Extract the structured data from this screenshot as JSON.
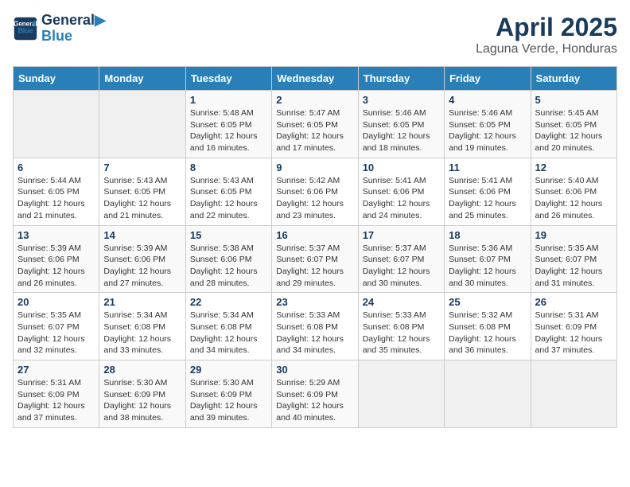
{
  "logo": {
    "line1": "General",
    "line2": "Blue"
  },
  "title": "April 2025",
  "subtitle": "Laguna Verde, Honduras",
  "headers": [
    "Sunday",
    "Monday",
    "Tuesday",
    "Wednesday",
    "Thursday",
    "Friday",
    "Saturday"
  ],
  "rows": [
    [
      {
        "empty": true
      },
      {
        "empty": true
      },
      {
        "day": 1,
        "sunrise": "5:48 AM",
        "sunset": "6:05 PM",
        "daylight": "12 hours and 16 minutes."
      },
      {
        "day": 2,
        "sunrise": "5:47 AM",
        "sunset": "6:05 PM",
        "daylight": "12 hours and 17 minutes."
      },
      {
        "day": 3,
        "sunrise": "5:46 AM",
        "sunset": "6:05 PM",
        "daylight": "12 hours and 18 minutes."
      },
      {
        "day": 4,
        "sunrise": "5:46 AM",
        "sunset": "6:05 PM",
        "daylight": "12 hours and 19 minutes."
      },
      {
        "day": 5,
        "sunrise": "5:45 AM",
        "sunset": "6:05 PM",
        "daylight": "12 hours and 20 minutes."
      }
    ],
    [
      {
        "day": 6,
        "sunrise": "5:44 AM",
        "sunset": "6:05 PM",
        "daylight": "12 hours and 21 minutes."
      },
      {
        "day": 7,
        "sunrise": "5:43 AM",
        "sunset": "6:05 PM",
        "daylight": "12 hours and 21 minutes."
      },
      {
        "day": 8,
        "sunrise": "5:43 AM",
        "sunset": "6:05 PM",
        "daylight": "12 hours and 22 minutes."
      },
      {
        "day": 9,
        "sunrise": "5:42 AM",
        "sunset": "6:06 PM",
        "daylight": "12 hours and 23 minutes."
      },
      {
        "day": 10,
        "sunrise": "5:41 AM",
        "sunset": "6:06 PM",
        "daylight": "12 hours and 24 minutes."
      },
      {
        "day": 11,
        "sunrise": "5:41 AM",
        "sunset": "6:06 PM",
        "daylight": "12 hours and 25 minutes."
      },
      {
        "day": 12,
        "sunrise": "5:40 AM",
        "sunset": "6:06 PM",
        "daylight": "12 hours and 26 minutes."
      }
    ],
    [
      {
        "day": 13,
        "sunrise": "5:39 AM",
        "sunset": "6:06 PM",
        "daylight": "12 hours and 26 minutes."
      },
      {
        "day": 14,
        "sunrise": "5:39 AM",
        "sunset": "6:06 PM",
        "daylight": "12 hours and 27 minutes."
      },
      {
        "day": 15,
        "sunrise": "5:38 AM",
        "sunset": "6:06 PM",
        "daylight": "12 hours and 28 minutes."
      },
      {
        "day": 16,
        "sunrise": "5:37 AM",
        "sunset": "6:07 PM",
        "daylight": "12 hours and 29 minutes."
      },
      {
        "day": 17,
        "sunrise": "5:37 AM",
        "sunset": "6:07 PM",
        "daylight": "12 hours and 30 minutes."
      },
      {
        "day": 18,
        "sunrise": "5:36 AM",
        "sunset": "6:07 PM",
        "daylight": "12 hours and 30 minutes."
      },
      {
        "day": 19,
        "sunrise": "5:35 AM",
        "sunset": "6:07 PM",
        "daylight": "12 hours and 31 minutes."
      }
    ],
    [
      {
        "day": 20,
        "sunrise": "5:35 AM",
        "sunset": "6:07 PM",
        "daylight": "12 hours and 32 minutes."
      },
      {
        "day": 21,
        "sunrise": "5:34 AM",
        "sunset": "6:08 PM",
        "daylight": "12 hours and 33 minutes."
      },
      {
        "day": 22,
        "sunrise": "5:34 AM",
        "sunset": "6:08 PM",
        "daylight": "12 hours and 34 minutes."
      },
      {
        "day": 23,
        "sunrise": "5:33 AM",
        "sunset": "6:08 PM",
        "daylight": "12 hours and 34 minutes."
      },
      {
        "day": 24,
        "sunrise": "5:33 AM",
        "sunset": "6:08 PM",
        "daylight": "12 hours and 35 minutes."
      },
      {
        "day": 25,
        "sunrise": "5:32 AM",
        "sunset": "6:08 PM",
        "daylight": "12 hours and 36 minutes."
      },
      {
        "day": 26,
        "sunrise": "5:31 AM",
        "sunset": "6:09 PM",
        "daylight": "12 hours and 37 minutes."
      }
    ],
    [
      {
        "day": 27,
        "sunrise": "5:31 AM",
        "sunset": "6:09 PM",
        "daylight": "12 hours and 37 minutes."
      },
      {
        "day": 28,
        "sunrise": "5:30 AM",
        "sunset": "6:09 PM",
        "daylight": "12 hours and 38 minutes."
      },
      {
        "day": 29,
        "sunrise": "5:30 AM",
        "sunset": "6:09 PM",
        "daylight": "12 hours and 39 minutes."
      },
      {
        "day": 30,
        "sunrise": "5:29 AM",
        "sunset": "6:09 PM",
        "daylight": "12 hours and 40 minutes."
      },
      {
        "empty": true
      },
      {
        "empty": true
      },
      {
        "empty": true
      }
    ]
  ]
}
